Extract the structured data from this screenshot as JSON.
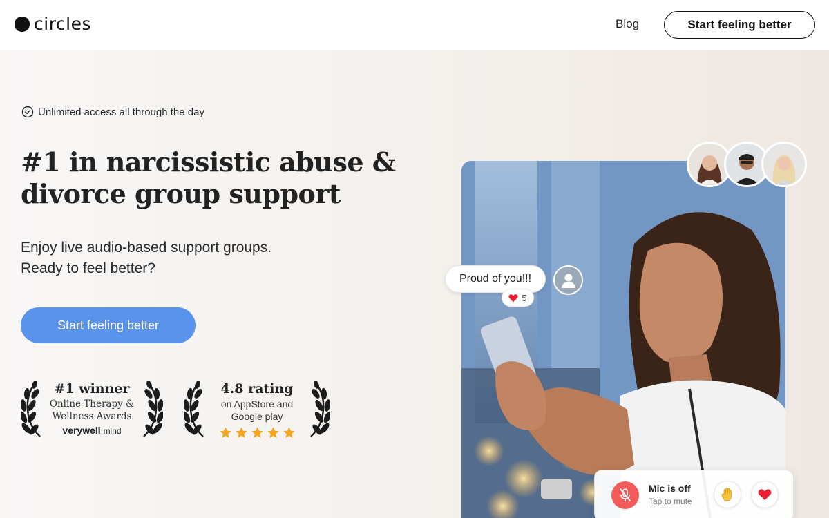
{
  "brand": {
    "name": "circles"
  },
  "nav": {
    "blog": "Blog",
    "cta": "Start feeling better"
  },
  "hero": {
    "badge": "Unlimited access all through the day",
    "headline_line1": "#1 in narcissistic abuse &",
    "headline_line2": "divorce group support",
    "sub_line1": "Enjoy live audio-based support groups.",
    "sub_line2": "Ready to feel better?",
    "cta": "Start feeling better"
  },
  "awards": [
    {
      "title": "#1 winner",
      "line1": "Online Therapy &",
      "line2": "Wellness Awards",
      "brand_bold": "verywell",
      "brand_light": "mind"
    },
    {
      "title": "4.8 rating",
      "line1": "on AppStore and",
      "line2": "Google play",
      "stars": 5
    }
  ],
  "chat": {
    "message": "Proud of you!!!",
    "reaction_count": "5"
  },
  "mic": {
    "title": "Mic is off",
    "subtitle": "Tap to mute"
  },
  "colors": {
    "primary": "#5a93ec",
    "mic_off": "#f35b5b",
    "star": "#f5a623",
    "heart": "#e8202f"
  },
  "icons": {
    "badge": "check-circle-icon",
    "mic": "mic-off-icon",
    "hand": "raised-hand-icon",
    "heart": "heart-icon",
    "user": "user-icon"
  }
}
